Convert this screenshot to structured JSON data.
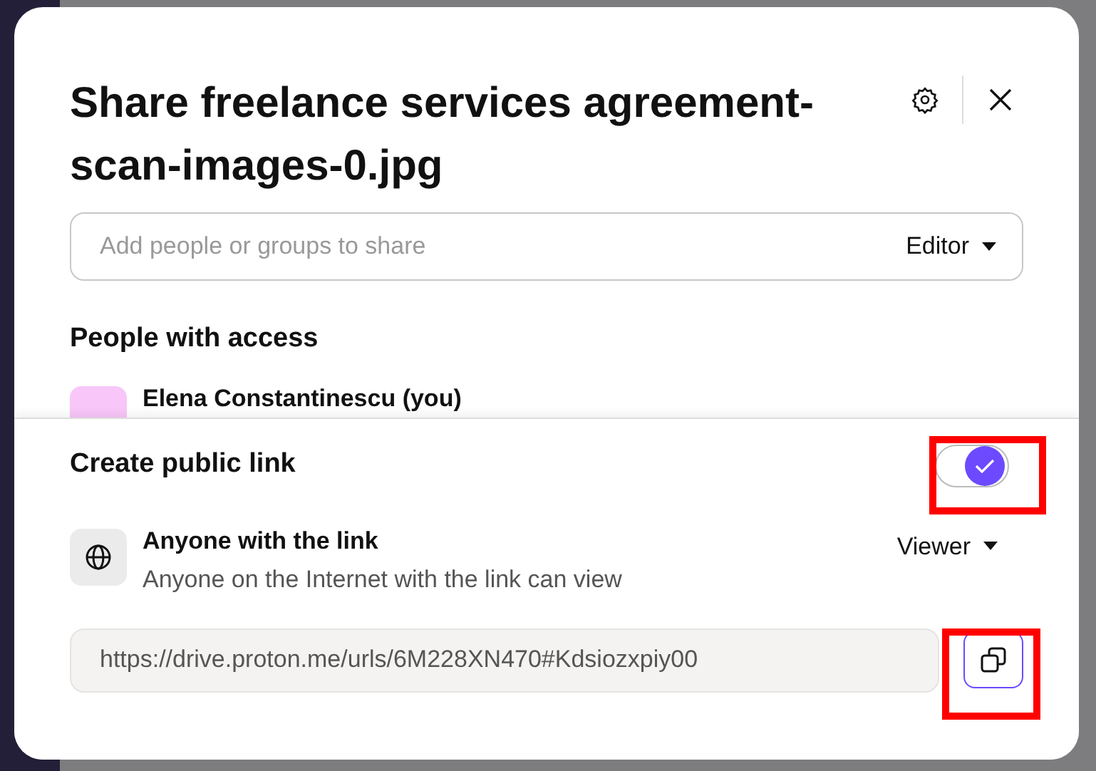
{
  "dialog": {
    "title": "Share freelance services agreement-scan-images-0.jpg"
  },
  "invite": {
    "placeholder": "Add people or groups to share",
    "role": "Editor"
  },
  "people": {
    "heading": "People with access",
    "members": [
      {
        "name": "Elena Constantinescu (you)"
      }
    ]
  },
  "public_link": {
    "label": "Create public link",
    "on": true,
    "highlighted": true
  },
  "link_access": {
    "title": "Anyone with the link",
    "description": "Anyone on the Internet with the link can view",
    "role": "Viewer"
  },
  "link_url": {
    "value": "https://drive.proton.me/urls/6M228XN470#Kdsiozxpiy00",
    "copy_highlighted": true
  }
}
